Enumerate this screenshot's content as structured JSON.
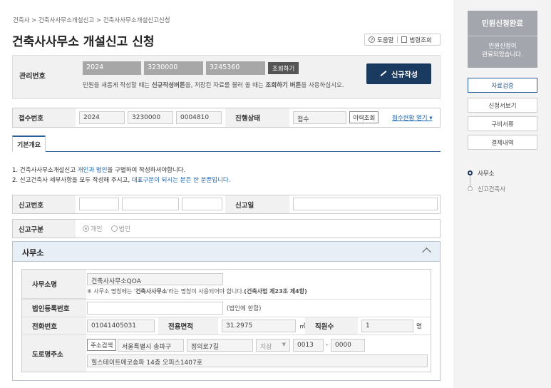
{
  "breadcrumb": "건축사 > 건축사사무소개설신고 > 건축사사무소개설신고신청",
  "page_title": "건축사사무소 개설신고 신청",
  "header_tools": {
    "help": "도움말",
    "law": "법령조회"
  },
  "management": {
    "label": "관리번호",
    "values": [
      "2024",
      "3230000",
      "3245360"
    ],
    "lookup_button": "조회하기",
    "note_parts": [
      "민원을 새롭게 작성할 때는 ",
      "신규작성버튼",
      "을, 저장된 자료를 불러 올 때는 ",
      "조회하기 버튼",
      "을 사용하십시오."
    ],
    "new_button": "신규작성"
  },
  "receipt": {
    "label": "접수번호",
    "values": [
      "2024",
      "3230000",
      "0004810"
    ],
    "status_label": "진행상태",
    "status_value": "접수",
    "history_button": "이력조회",
    "status_link": "접수현황 열기 ▾"
  },
  "tabs": [
    "기본개요"
  ],
  "notes": {
    "line1_parts": [
      "1. 건축사사무소개설신고 ",
      "개인과 법인",
      "을 구별하여 작성하셔야합니다."
    ],
    "line2_parts": [
      "2. 신고건축사 세부사항을 모두 작성해 주시고, ",
      "대표구분이 되시는 분은 한 분뿐입니다."
    ]
  },
  "report": {
    "number_label": "신고번호",
    "date_label": "신고일"
  },
  "report_type": {
    "label": "신고구분",
    "options": [
      "개인",
      "법인"
    ],
    "selected": "개인"
  },
  "office": {
    "section_title": "사무소",
    "name_label": "사무소명",
    "name_value": "건축사사무소QOA",
    "name_note_parts": [
      "※ 사무소 명칭에는 '",
      "건축사사무소",
      "'라는 명칭이 사용되어야 합니다.",
      "(건축사법 제23조 제4항)"
    ],
    "corp_label": "법인등록번호",
    "corp_note": "(법인에 한함)",
    "phone_label": "전화번호",
    "phone_value": "01041405031",
    "area_label": "전용면적",
    "area_value": "31.2975",
    "area_unit": "㎡",
    "staff_label": "직원수",
    "staff_value": "1",
    "staff_unit": "명",
    "address_label": "도로명주소",
    "address_search": "주소검색",
    "address_city": "서울특별시 송파구",
    "address_road": "정의로7길",
    "address_type": "지상",
    "address_num1": "0013",
    "address_dash": "-",
    "address_num2": "0000",
    "address_detail": "힐스테이트에코송파 14층 오피스1407호"
  },
  "sidebar": {
    "status_title": "민원신청완료",
    "status_text_1": "민원신청이",
    "status_text_2": "완료되었습니다.",
    "buttons": [
      "자료검증",
      "신청서보기",
      "구비서류",
      "결제내역"
    ],
    "steps": [
      "사무소",
      "신고건축사"
    ]
  },
  "colors": {
    "navy": "#1b3a60",
    "link": "#1b66b3",
    "sidebar_bg": "#f3f3f3",
    "status_box": "#a3a6ad"
  }
}
